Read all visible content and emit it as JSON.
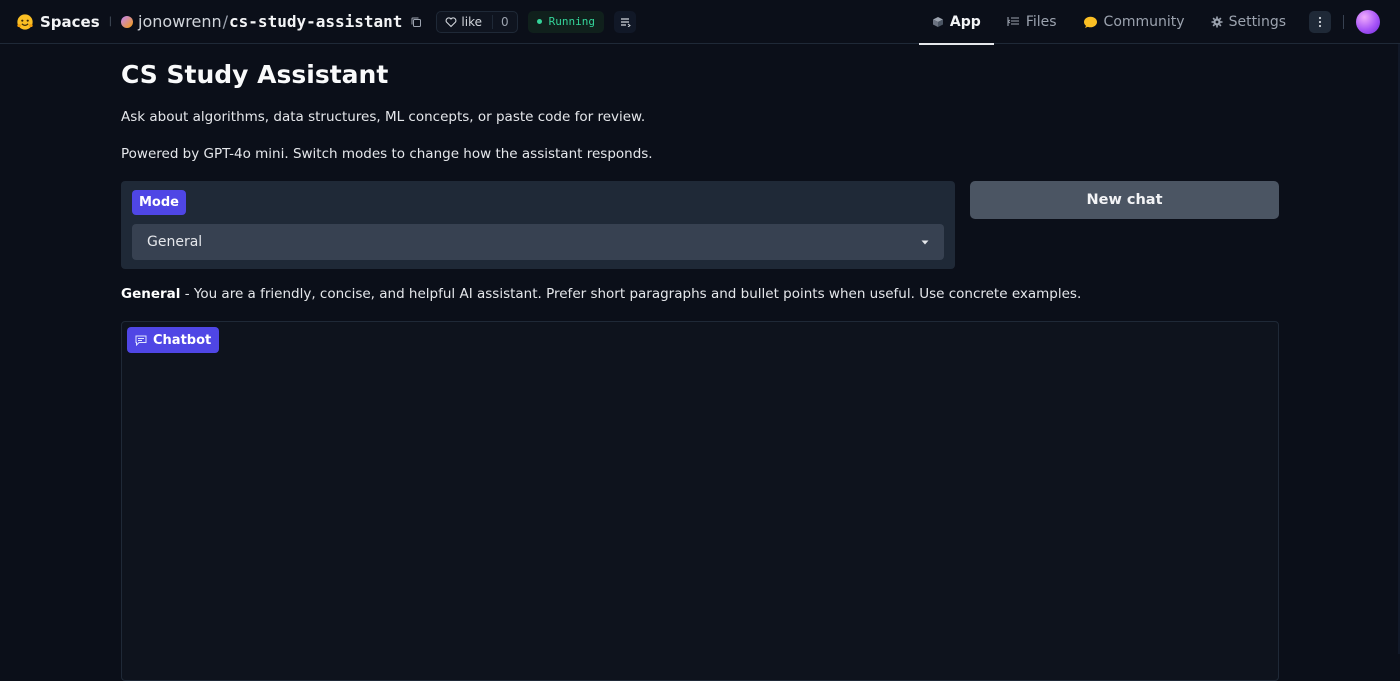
{
  "header": {
    "spaces_label": "Spaces",
    "owner": "jonowrenn",
    "separator": "/",
    "repo": "cs-study-assistant",
    "like_label": "like",
    "like_count": "0",
    "status": "Running",
    "nav": [
      {
        "label": "App",
        "icon": "cube-icon",
        "active": true
      },
      {
        "label": "Files",
        "icon": "files-icon",
        "active": false
      },
      {
        "label": "Community",
        "icon": "community-icon",
        "active": false
      },
      {
        "label": "Settings",
        "icon": "gear-icon",
        "active": false
      }
    ]
  },
  "main": {
    "title": "CS Study Assistant",
    "description_1": "Ask about algorithms, data structures, ML concepts, or paste code for review.",
    "description_2": "Powered by GPT-4o mini. Switch modes to change how the assistant responds.",
    "mode": {
      "label": "Mode",
      "selected": "General"
    },
    "new_chat_label": "New chat",
    "mode_description": {
      "name": "General",
      "text": " - You are a friendly, concise, and helpful AI assistant. Prefer short paragraphs and bullet points when useful. Use concrete examples."
    },
    "chatbot_label": "Chatbot"
  },
  "colors": {
    "background": "#0b0f19",
    "accent": "#4f46e5",
    "running": "#34d399",
    "panel": "#1f2937"
  }
}
